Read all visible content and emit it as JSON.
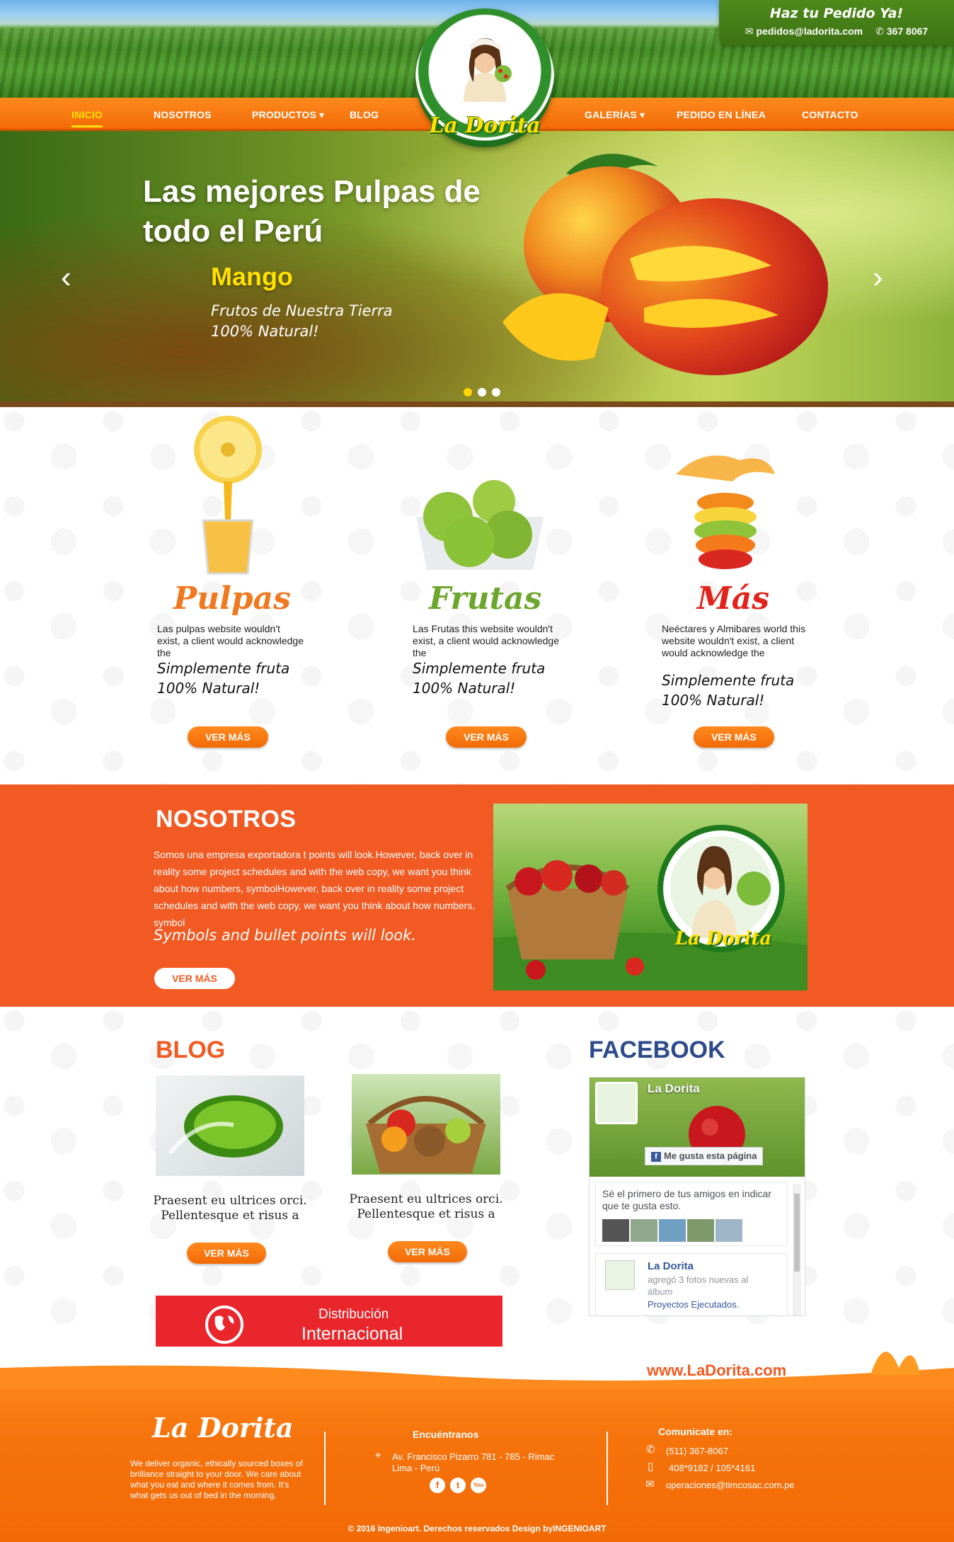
{
  "header": {
    "order_title": "Haz tu Pedido Ya!",
    "email": "pedidos@ladorita.com",
    "phone": "367 8067",
    "logo_text": "La Dorita",
    "nav": [
      {
        "label": "INICIO",
        "active": true
      },
      {
        "label": "NOSOTROS"
      },
      {
        "label": "PRODUCTOS ▾"
      },
      {
        "label": "BLOG"
      },
      {
        "label": "GALERÍAS ▾"
      },
      {
        "label": "PEDIDO EN LÍNEA"
      },
      {
        "label": "CONTACTO"
      }
    ]
  },
  "hero": {
    "title": "Las mejores Pulpas de todo el Perú",
    "subtitle": "Mango",
    "tagline": "Frutos de Nuestra Tierra 100% Natural!",
    "prev_icon": "chevron-left-icon",
    "next_icon": "chevron-right-icon",
    "slides": 3,
    "active_slide": 1
  },
  "products": [
    {
      "title": "Pulpas",
      "color": "#f0781e",
      "desc": "Las pulpas website wouldn't exist, a client would acknowledge the",
      "quote": "Simplemente fruta 100% Natural!",
      "button": "VER MÁS"
    },
    {
      "title": "Frutas",
      "color": "#6da62c",
      "desc": "Las Frutas this website wouldn't exist, a client would acknowledge the",
      "quote": "Simplemente fruta 100% Natural!",
      "button": "VER MÁS"
    },
    {
      "title": "Más",
      "color": "#e2231a",
      "desc": "Neéctares y Almibares world this website wouldn't exist, a client would acknowledge the",
      "quote": "Simplemente fruta 100% Natural!",
      "button": "VER MÁS"
    }
  ],
  "about": {
    "title": "NOSOTROS",
    "text": "Somos una empresa exportadora t points will look.However, back over in reality some project schedules and with the web copy, we want you think about how numbers, symbolHowever, back over in reality some project schedules and with the web copy, we want you think about how numbers, symbol",
    "quote": "Symbols and bullet points will look.",
    "button": "VER MÁS",
    "photo_logo": "La Dorita"
  },
  "blog": {
    "title": "BLOG",
    "posts": [
      {
        "caption": "Praesent eu ultrices orci. Pellentesque et risus a",
        "button": "VER MÁS"
      },
      {
        "caption": "Praesent eu ultrices orci. Pellentesque et risus a",
        "button": "VER MÁS"
      }
    ],
    "banner_line1": "Distribución",
    "banner_line2": "Internacional"
  },
  "facebook": {
    "title": "FACEBOOK",
    "page_name": "La Dorita",
    "like_label": "Me gusta esta página",
    "friends_text": "Sé el primero de tus amigos en indicar que te gusta esto.",
    "post_name": "La Dorita",
    "post_text": "agregó 3 fotos nuevas al álbum",
    "post_link": "Proyectos Ejecutados."
  },
  "footer": {
    "url": "www.LaDorita.com",
    "logo": "La Dorita",
    "about": "We deliver organic, ethically sourced boxes of brilliance straight to your door. We care about what you eat and where it comes from. It's what gets us out of bed in the morning.",
    "find_title": "Encuéntranos",
    "address": "Av. Francisco Pizarro 781 - 785 - Rimac Lima - Perú",
    "contact_title": "Comunicate en:",
    "phone1": "(511) 367-8067",
    "phone2": "408*9182 / 105*4161",
    "email": "operaciones@timcosac.com.pe",
    "social": [
      "f",
      "t",
      "You"
    ],
    "copyright": "© 2016 Ingenioart. Derechos reservados Design byINGENIOART"
  }
}
